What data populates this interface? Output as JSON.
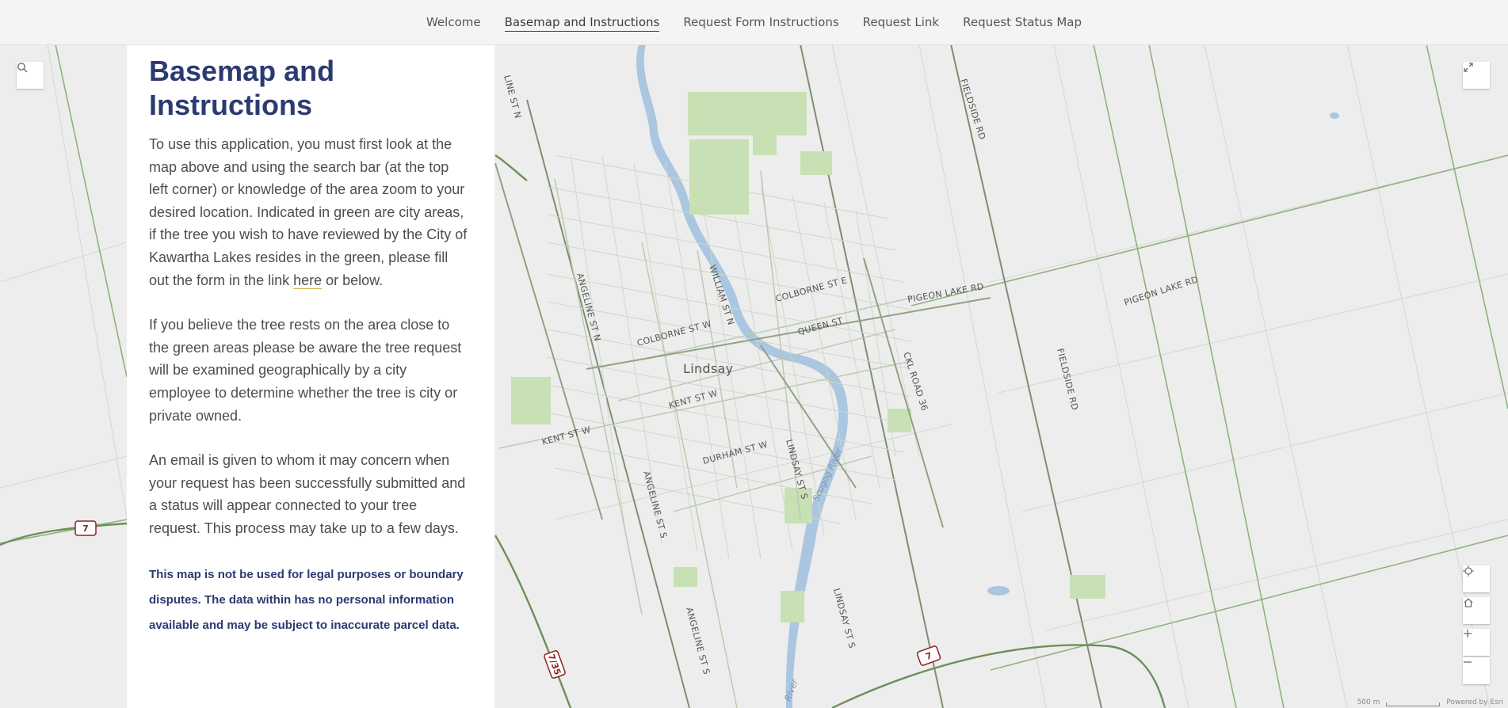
{
  "nav": {
    "items": [
      {
        "label": "Welcome"
      },
      {
        "label": "Basemap and Instructions",
        "active": true
      },
      {
        "label": "Request Form Instructions"
      },
      {
        "label": "Request Link"
      },
      {
        "label": "Request Status Map"
      }
    ]
  },
  "panel": {
    "title": "Basemap and Instructions",
    "p1_before": "To use this application, you must first look at the map above and using the search bar (at the top left corner) or knowledge of the area zoom to your desired location. Indicated in green are city areas, if the tree you wish to have reviewed by the City of Kawartha Lakes resides in the green, please fill out the form in the link ",
    "p1_link": "here",
    "p1_after": " or below.",
    "p2": "If you believe the tree rests on the area close to the green areas please be aware the tree request will be examined geographically by a city employee to determine  whether the tree is city or private owned.",
    "p3": "An email is given to whom it may concern when your request has been successfully submitted and a status will appear connected to your tree request. This process may take up to a few days.",
    "disclaimer": "This map is not be used for legal purposes or boundary disputes. The data within has no personal information available and may be subject to inaccurate parcel data."
  },
  "map": {
    "city": "Lindsay",
    "river": "Scugog River",
    "river_small": "River",
    "roads": {
      "fieldside_top": "FIELDSIDE RD",
      "fieldside_mid": "FIELDSIDE RD",
      "pigeon_lake_1": "PIGEON LAKE RD",
      "pigeon_lake_2": "PIGEON LAKE RD",
      "colborne_e": "COLBORNE ST E",
      "colborne_w": "COLBORNE ST W",
      "queen": "QUEEN ST",
      "kent_w_inner": "KENT ST W",
      "kent_w_outer": "KENT ST W",
      "angeline_n": "ANGELINE ST N",
      "angeline_s_1": "ANGELINE ST S",
      "angeline_s_2": "ANGELINE ST S",
      "william_n": "WILLIAM ST N",
      "durham_w": "DURHAM ST W",
      "lindsay_s_1": "LINDSAY ST S",
      "lindsay_s_2": "LINDSAY ST S",
      "ckl36": "CKL ROAD 36",
      "line_top": "LINE ST N"
    },
    "shields": {
      "hwy7_left": "7",
      "hwy7_right": "7",
      "hwy735": "7/35"
    },
    "attribution": {
      "scale": "500 m",
      "powered": "Powered by Esri"
    }
  },
  "colors": {
    "title": "#2c3a72",
    "road_major": "#6d8f5a",
    "green_area": "#c7e0b4",
    "water": "#aac6e0",
    "link_underline": "#d4b04a"
  }
}
